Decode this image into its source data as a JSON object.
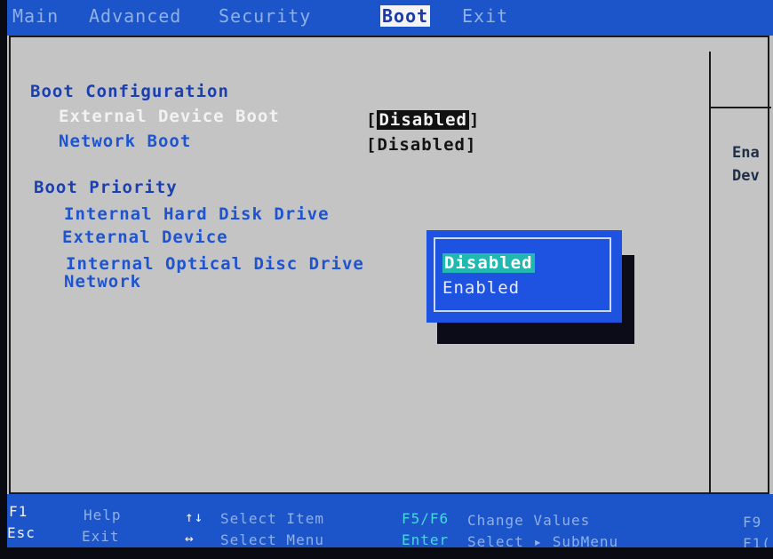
{
  "menu": {
    "items": [
      {
        "label": "Main",
        "active": false
      },
      {
        "label": "Advanced",
        "active": false
      },
      {
        "label": "Security",
        "active": false
      },
      {
        "label": "Boot",
        "active": true
      },
      {
        "label": "Exit",
        "active": false
      }
    ]
  },
  "help": {
    "lines": [
      "Ena",
      "Dev"
    ]
  },
  "boot_configuration": {
    "title": "Boot Configuration",
    "items": [
      {
        "label": "External Device Boot",
        "value": "Disabled",
        "selected": true
      },
      {
        "label": "Network Boot",
        "value": "Disabled",
        "selected": false
      }
    ]
  },
  "boot_priority": {
    "title": "Boot Priority",
    "items": [
      "Internal Hard Disk Drive",
      "External Device",
      "Internal Optical Disc Drive",
      "Network"
    ]
  },
  "popup": {
    "options": [
      {
        "label": "Disabled",
        "selected": true
      },
      {
        "label": "Enabled",
        "selected": false
      }
    ]
  },
  "keybar": {
    "f1": "F1",
    "help": "Help",
    "esc": "Esc",
    "exit": "Exit",
    "updown": "↑↓",
    "select_item": "Select Item",
    "leftright": "↔",
    "select_menu": "Select Menu",
    "f5f6": "F5/F6",
    "change_values": "Change Values",
    "enter": "Enter",
    "select_submenu": "Select ▸ SubMenu",
    "f9": "F9",
    "f10": "F1("
  },
  "colors": {
    "menubar": "#1b55c9",
    "background": "#c4c4c4",
    "item_text": "#1e54d0",
    "selected_item": "#f2f2f2",
    "popup_bg": "#1e52e0",
    "popup_selection": "#20b8b0"
  }
}
